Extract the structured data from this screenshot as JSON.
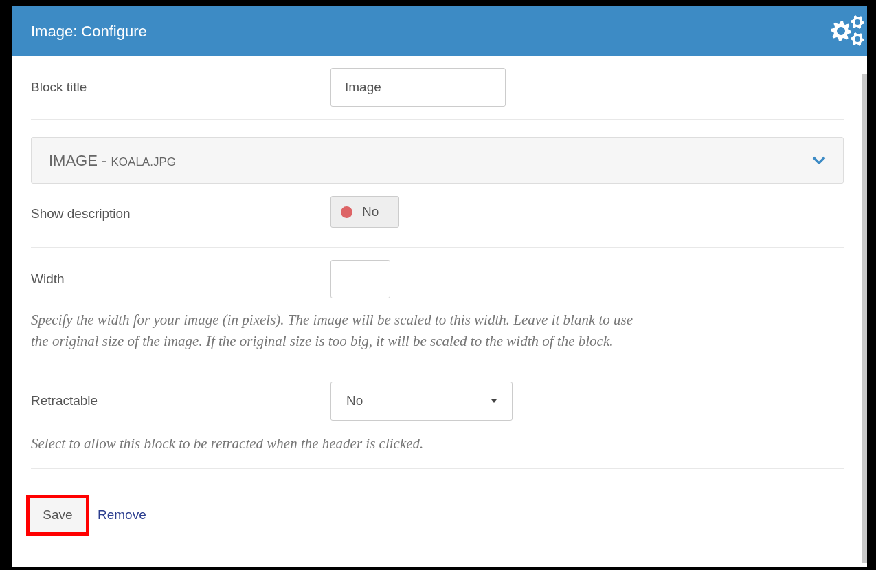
{
  "dialog": {
    "title": "Image: Configure"
  },
  "block_title": {
    "label": "Block title",
    "value": "Image"
  },
  "image_section": {
    "heading": "IMAGE",
    "separator": "-",
    "filename": "KOALA.JPG",
    "expanded": false
  },
  "show_description": {
    "label": "Show description",
    "on": false,
    "state_text": "No"
  },
  "width": {
    "label": "Width",
    "help": "Specify the width for your image (in pixels). The image will be scaled to this width. Leave it blank to use the original size of the image. If the original size is too big, it will be scaled to the width of the block."
  },
  "retractable": {
    "label": "Retractable",
    "value": "No",
    "help": "Select to allow this block to be retracted when the header is clicked."
  },
  "actions": {
    "save": "Save",
    "remove": "Remove",
    "save_highlighted": true
  }
}
